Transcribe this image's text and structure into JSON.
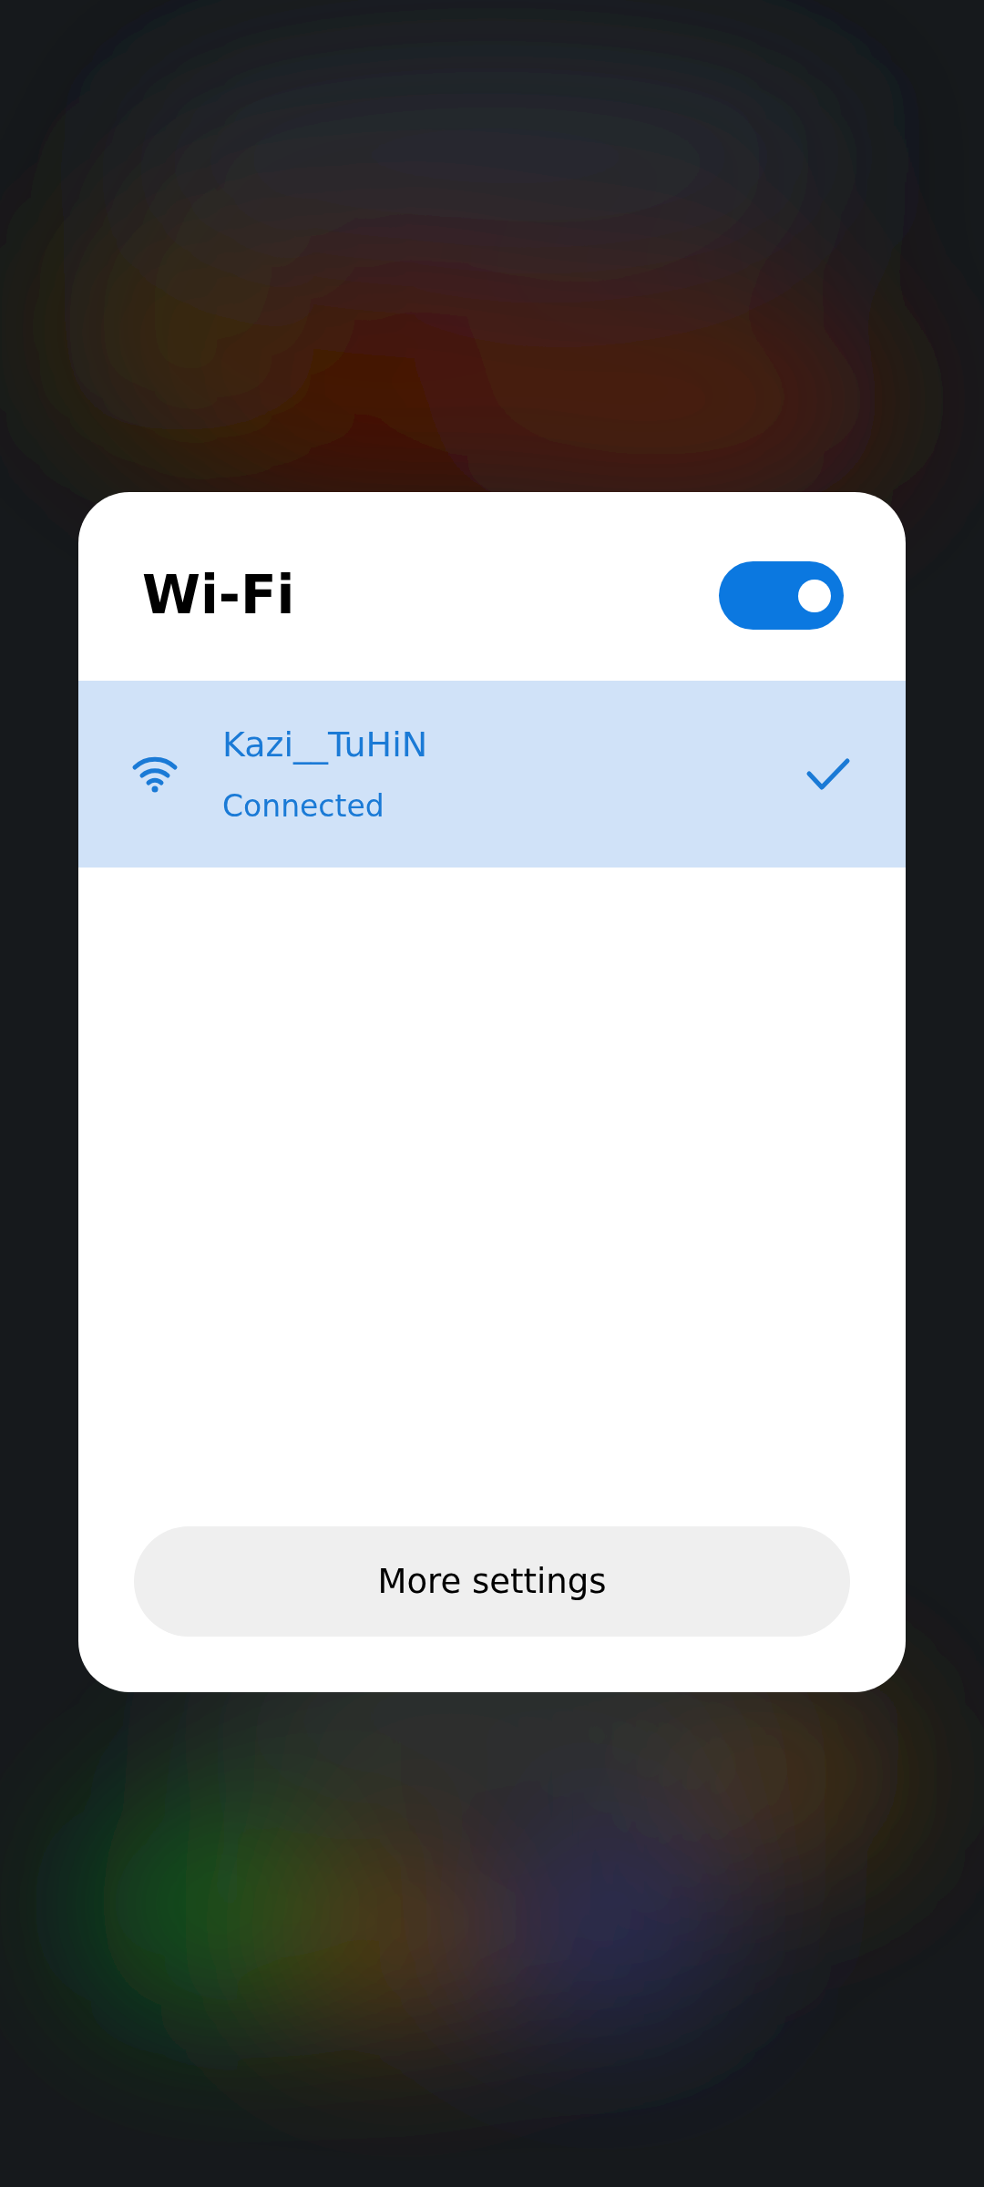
{
  "dialog": {
    "title": "Wi-Fi",
    "wifi_on": true
  },
  "networks": [
    {
      "name": "Kazi__TuHiN",
      "status": "Connected",
      "selected": true
    }
  ],
  "buttons": [
    {
      "label": "More settings"
    }
  ]
}
